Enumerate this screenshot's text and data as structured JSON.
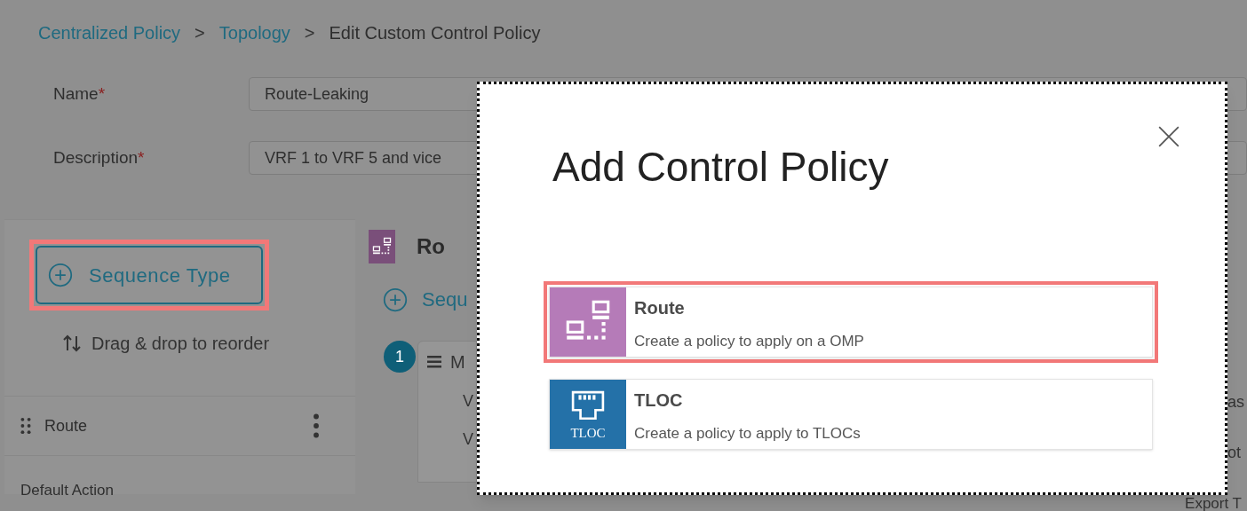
{
  "breadcrumb": [
    {
      "label": "Centralized Policy",
      "kind": "link"
    },
    {
      "label": "Topology",
      "kind": "link"
    },
    {
      "label": "Edit Custom Control Policy",
      "kind": "current"
    }
  ],
  "breadcrumb_separator": ">",
  "form": [
    {
      "label": "Name",
      "required_mark": "*",
      "value": "Route-Leaking"
    },
    {
      "label": "Description",
      "required_mark": "*",
      "value": "VRF 1 to VRF 5 and vice"
    }
  ],
  "sidebar": {
    "add_button": {
      "label": "Sequence Type",
      "highlighted": true
    },
    "hint": "Drag & drop to reorder",
    "sequences": [
      {
        "name": "Route"
      }
    ],
    "default_action": "Default Action"
  },
  "main": {
    "title": "Ro",
    "add_label": "Sequ",
    "step": "1",
    "card_header": "M",
    "rows": [
      "V",
      "V"
    ]
  },
  "right_edge": [
    "as",
    "ot",
    "Export T"
  ],
  "modal": {
    "title": "Add Control Policy",
    "options": [
      {
        "kind": "route",
        "title": "Route",
        "description": "Create a policy to apply on a OMP",
        "highlighted": true
      },
      {
        "kind": "tloc",
        "title": "TLOC",
        "description": "Create a policy to apply to TLOCs",
        "icon_label": "TLOC",
        "highlighted": false
      }
    ]
  }
}
